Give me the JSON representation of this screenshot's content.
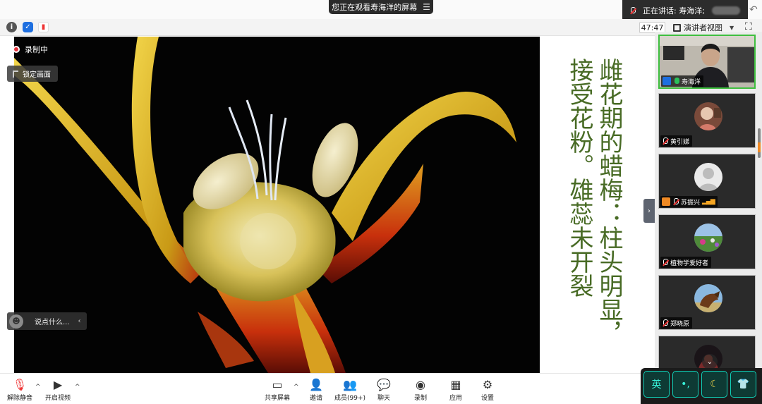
{
  "banner": {
    "text": "您正在观看寿海洋的屏幕",
    "menu_icon": "menu-icon"
  },
  "speaker": {
    "label": "正在讲话: 寿海洋;",
    "icon": "mic-icon"
  },
  "toolbar": {
    "timer": "47:47",
    "view_label": "演讲者视图"
  },
  "overlay": {
    "recording": "录制中",
    "lock_screen": "锁定画面",
    "chat_placeholder": "说点什么..."
  },
  "slide": {
    "line1": "雌花期的蜡梅：柱头明显，",
    "line2": "接受花粉。雄蕊未开裂"
  },
  "participants": [
    {
      "name": "寿海洋",
      "mic": "on",
      "badge": "blue"
    },
    {
      "name": "黄引娣",
      "mic": "off"
    },
    {
      "name": "苏振兴",
      "mic": "off",
      "badge": "orange",
      "signal": true
    },
    {
      "name": "植物学爱好者",
      "mic": "off"
    },
    {
      "name": "郑晓原",
      "mic": "off"
    }
  ],
  "bottom": {
    "unmute": "解除静音",
    "video": "开启视频",
    "share": "共享屏幕",
    "invite": "邀请",
    "members": "成员(99+)",
    "chat": "聊天",
    "record": "录制",
    "apps": "应用",
    "settings": "设置"
  },
  "ime": {
    "lang": "英"
  },
  "colors": {
    "slide_text": "#486b25",
    "speaking_border": "#3fbf3f",
    "record_dot": "#e2303a"
  }
}
